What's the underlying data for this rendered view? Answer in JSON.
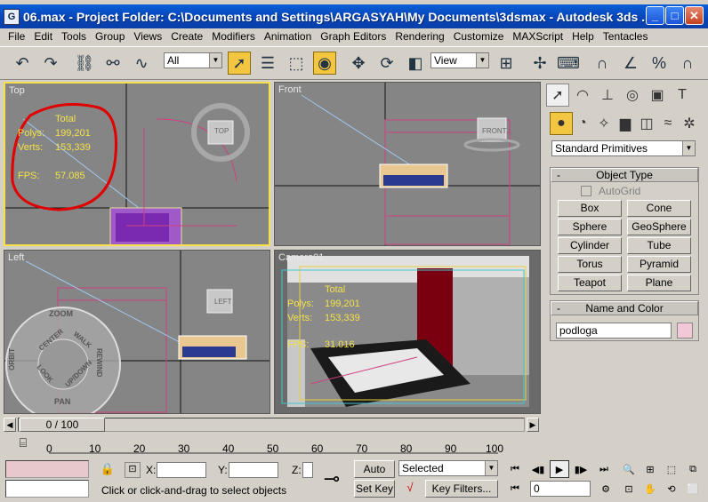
{
  "titlebar": {
    "app_icon": "app-icon",
    "title": "06.max   - Project Folder: C:\\Documents and Settings\\ARGASYAH\\My Documents\\3dsmax   - Autodesk 3ds ..."
  },
  "menu": [
    "File",
    "Edit",
    "Tools",
    "Group",
    "Views",
    "Create",
    "Modifiers",
    "Animation",
    "Graph Editors",
    "Rendering",
    "Customize",
    "MAXScript",
    "Help",
    "Tentacles"
  ],
  "toolbar": {
    "selection_filter": "All",
    "ref_coord": "View"
  },
  "viewports": {
    "top": {
      "label": "Top",
      "stats": {
        "total": "Total",
        "polys_label": "Polys:",
        "polys": "199,201",
        "verts_label": "Verts:",
        "verts": "153,339",
        "fps_label": "FPS:",
        "fps": "57.085"
      },
      "gizmo": "TOP"
    },
    "front": {
      "label": "Front",
      "gizmo": "FRONT"
    },
    "left": {
      "label": "Left",
      "gizmo": "LEFT",
      "wheel": {
        "zoom": "ZOOM",
        "orbit": "ORBIT",
        "center": "CENTER",
        "walk": "WALK",
        "rewind": "REWIND",
        "look": "LOOK",
        "updown": "UP/DOWN",
        "pan": "PAN"
      }
    },
    "camera": {
      "label": "Camera01",
      "stats": {
        "total": "Total",
        "polys_label": "Polys:",
        "polys": "199,201",
        "verts_label": "Verts:",
        "verts": "153,339",
        "fps_label": "FPS:",
        "fps": "31.016"
      }
    }
  },
  "command_panel": {
    "category": "Standard Primitives",
    "object_type_title": "Object Type",
    "autogrid": "AutoGrid",
    "buttons": [
      "Box",
      "Cone",
      "Sphere",
      "GeoSphere",
      "Cylinder",
      "Tube",
      "Torus",
      "Pyramid",
      "Teapot",
      "Plane"
    ],
    "name_color_title": "Name and Color",
    "object_name": "podloga",
    "color": "#f2c8d8"
  },
  "timeline": {
    "frame": "0 / 100",
    "ticks": [
      "0",
      "10",
      "20",
      "30",
      "40",
      "50",
      "60",
      "70",
      "80",
      "90",
      "100"
    ]
  },
  "status": {
    "x_label": "X:",
    "y_label": "Y:",
    "z_label": "Z:",
    "auto_key": "Auto Key",
    "set_key": "Set Key",
    "key_mode": "Selected",
    "key_filters": "Key Filters...",
    "frame_value": "0",
    "prompt": "Click or click-and-drag to select objects"
  },
  "colors": {
    "active_viewport": "#f7e04a",
    "viewport_bg": "#858585",
    "stats_yellow": "#f3e14a",
    "annotation_red": "#e00000",
    "highlight_button": "#f2c640"
  }
}
